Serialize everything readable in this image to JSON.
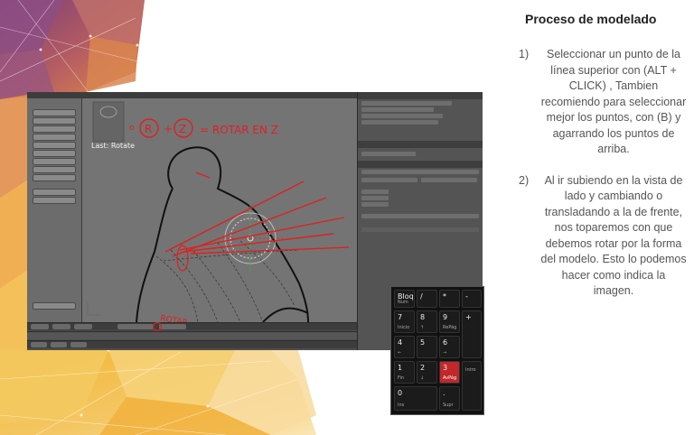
{
  "slide": {
    "title": "Proceso de modelado",
    "steps": [
      {
        "number": "1)",
        "text": "Seleccionar un punto de la línea superior con (ALT + CLICK) , Tambien recomiendo para seleccionar mejor los puntos, con (B) y agarrando los puntos de arriba."
      },
      {
        "number": "2)",
        "text": "Al ir subiendo en la vista de lado y cambiando o transladando a la de frente, nos toparemos con que debemos rotar por la forma del modelo. Esto lo podemos hacer como indica la imagen."
      }
    ]
  },
  "screenshot": {
    "viewport_info": "Last: Rotate",
    "annotation_text": "= ROTAR EN Z",
    "annotation_key_r": "R",
    "annotation_key_z": "Z",
    "annotation_rotar": "ROTAR",
    "annotation_color": "#e0201e"
  },
  "numpad": {
    "keys": [
      {
        "main": "Bloq",
        "sub": "Num"
      },
      {
        "main": "/",
        "sub": ""
      },
      {
        "main": "*",
        "sub": ""
      },
      {
        "main": "-",
        "sub": ""
      },
      {
        "main": "7",
        "sub": "Inicio"
      },
      {
        "main": "8",
        "sub": "↑"
      },
      {
        "main": "9",
        "sub": "RePág"
      },
      {
        "main": "+",
        "sub": ""
      },
      {
        "main": "4",
        "sub": "←"
      },
      {
        "main": "5",
        "sub": ""
      },
      {
        "main": "6",
        "sub": "→"
      },
      {
        "main": "1",
        "sub": "Fin"
      },
      {
        "main": "2",
        "sub": "↓"
      },
      {
        "main": "3",
        "sub": "AvPág"
      },
      {
        "main": "",
        "sub": "Intro"
      },
      {
        "main": "0",
        "sub": "Ins"
      },
      {
        "main": ".",
        "sub": "Supr"
      }
    ],
    "highlight_color": "#c0282a"
  }
}
